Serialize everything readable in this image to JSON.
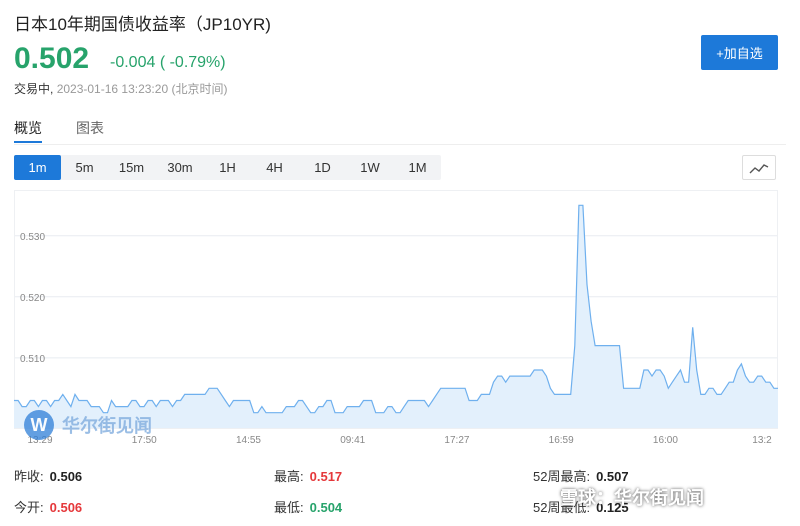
{
  "header": {
    "title": "日本10年期国债收益率（JP10YR)",
    "price": "0.502",
    "change": "-0.004 ( -0.79%)",
    "status_label": "交易中,",
    "timestamp": "2023-01-16 13:23:20 (北京时间)"
  },
  "add_button_label": "+加自选",
  "tabs": [
    {
      "label": "概览",
      "active": true
    },
    {
      "label": "图表",
      "active": false
    }
  ],
  "ranges": [
    "1m",
    "5m",
    "15m",
    "30m",
    "1H",
    "4H",
    "1D",
    "1W",
    "1M"
  ],
  "active_range": "1m",
  "colors": {
    "accent": "#1d79d9",
    "up": "#e5383b",
    "down": "#27a36b",
    "line": "#6fb0ee",
    "fill": "#e3f0fc"
  },
  "chart_data": {
    "type": "area",
    "y_ticks": [
      "0.510",
      "0.520",
      "0.530"
    ],
    "ylim": [
      0.4985,
      0.5375
    ],
    "x_ticks": [
      "13:29",
      "17:50",
      "14:55",
      "09:41",
      "17:27",
      "16:59",
      "16:00",
      "13:2"
    ],
    "grid": true,
    "values": [
      0.503,
      0.503,
      0.502,
      0.502,
      0.503,
      0.503,
      0.502,
      0.503,
      0.503,
      0.502,
      0.503,
      0.503,
      0.504,
      0.503,
      0.502,
      0.504,
      0.503,
      0.503,
      0.503,
      0.502,
      0.502,
      0.502,
      0.501,
      0.501,
      0.503,
      0.502,
      0.502,
      0.502,
      0.502,
      0.503,
      0.503,
      0.502,
      0.502,
      0.503,
      0.503,
      0.502,
      0.503,
      0.503,
      0.503,
      0.502,
      0.503,
      0.503,
      0.504,
      0.504,
      0.504,
      0.504,
      0.504,
      0.504,
      0.505,
      0.505,
      0.505,
      0.504,
      0.503,
      0.502,
      0.503,
      0.503,
      0.503,
      0.503,
      0.503,
      0.501,
      0.501,
      0.502,
      0.501,
      0.501,
      0.501,
      0.501,
      0.501,
      0.502,
      0.502,
      0.502,
      0.503,
      0.503,
      0.502,
      0.501,
      0.501,
      0.502,
      0.502,
      0.503,
      0.503,
      0.501,
      0.501,
      0.501,
      0.502,
      0.502,
      0.502,
      0.502,
      0.503,
      0.503,
      0.503,
      0.501,
      0.501,
      0.501,
      0.502,
      0.502,
      0.501,
      0.501,
      0.502,
      0.503,
      0.503,
      0.503,
      0.503,
      0.503,
      0.502,
      0.503,
      0.504,
      0.505,
      0.505,
      0.505,
      0.505,
      0.505,
      0.505,
      0.505,
      0.503,
      0.503,
      0.503,
      0.504,
      0.504,
      0.504,
      0.506,
      0.507,
      0.507,
      0.506,
      0.507,
      0.507,
      0.507,
      0.507,
      0.507,
      0.507,
      0.508,
      0.508,
      0.508,
      0.507,
      0.505,
      0.504,
      0.504,
      0.504,
      0.504,
      0.504,
      0.512,
      0.535,
      0.535,
      0.522,
      0.516,
      0.512,
      0.512,
      0.512,
      0.512,
      0.512,
      0.512,
      0.512,
      0.505,
      0.505,
      0.505,
      0.505,
      0.505,
      0.508,
      0.508,
      0.507,
      0.508,
      0.508,
      0.507,
      0.505,
      0.506,
      0.507,
      0.508,
      0.506,
      0.506,
      0.515,
      0.508,
      0.504,
      0.504,
      0.505,
      0.505,
      0.504,
      0.504,
      0.505,
      0.506,
      0.506,
      0.508,
      0.509,
      0.507,
      0.506,
      0.506,
      0.507,
      0.507,
      0.506,
      0.506,
      0.505,
      0.505
    ]
  },
  "watermark": {
    "logo_letter": "W",
    "text": "华尔街见闻"
  },
  "stats": [
    {
      "label": "昨收:",
      "value": "0.506",
      "color": "black"
    },
    {
      "label": "最高:",
      "value": "0.517",
      "color": "red"
    },
    {
      "label": "52周最高:",
      "value": "0.507",
      "color": "black"
    },
    {
      "label": "今开:",
      "value": "0.506",
      "color": "red"
    },
    {
      "label": "最低:",
      "value": "0.504",
      "color": "green"
    },
    {
      "label": "52周最低:",
      "value": "0.125",
      "color": "black"
    }
  ],
  "corner_watermark": "雪球：华尔街见闻"
}
